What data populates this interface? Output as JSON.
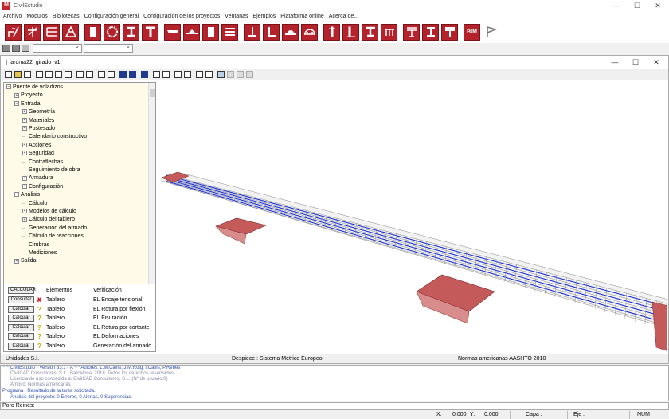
{
  "window": {
    "title": "CivilEstudio",
    "logo_text": "M",
    "minimize": "—",
    "maximize": "☐",
    "close": "✕"
  },
  "menu": [
    "Archivo",
    "Módulos",
    "Bibliotecas",
    "Configuración general",
    "Configuración de los proyectos",
    "Ventanas",
    "Ejemplos",
    "Plataforma online",
    "Acerca de..."
  ],
  "toolbar_icons": [
    "steel-section-icon",
    "beam-section-icon",
    "stacked-beam-icon",
    "truss-icon",
    "box-section-icon",
    "circular-section-icon",
    "i-beam-icon",
    "t-beam-icon",
    "deck-slab-icon",
    "arch-deck-icon",
    "document-icon",
    "stack-icon",
    "column-icon",
    "pier-icon",
    "bridge-deck-icon",
    "arch-bridge-icon",
    "single-column-icon",
    "double-column-icon",
    "girder-icon",
    "frame-icon",
    "deck-girder-icon",
    "wide-flange-icon",
    "t-girder-icon",
    "bim-icon",
    "flag-icon"
  ],
  "bim_label": "BIM",
  "child": {
    "title": "aroma22_girado_v1",
    "icon": "I",
    "minimize": "—",
    "maximize": "☐",
    "close": "✕"
  },
  "tree": [
    {
      "label": "Puente de voladizos",
      "indent": 0,
      "exp": "−"
    },
    {
      "label": "Proyecto",
      "indent": 1,
      "exp": "+"
    },
    {
      "label": "Entrada",
      "indent": 1,
      "exp": "−"
    },
    {
      "label": "Geometría",
      "indent": 2,
      "exp": "+"
    },
    {
      "label": "Materiales",
      "indent": 2,
      "exp": "+"
    },
    {
      "label": "Postesado",
      "indent": 2,
      "exp": "+"
    },
    {
      "label": "Calendario constructivo",
      "indent": 2,
      "exp": ""
    },
    {
      "label": "Acciones",
      "indent": 2,
      "exp": "+"
    },
    {
      "label": "Seguridad",
      "indent": 2,
      "exp": "+"
    },
    {
      "label": "Contraflechas",
      "indent": 2,
      "exp": ""
    },
    {
      "label": "Seguimiento de obra",
      "indent": 2,
      "exp": ""
    },
    {
      "label": "Armadura",
      "indent": 2,
      "exp": "+"
    },
    {
      "label": "Configuración",
      "indent": 2,
      "exp": "+"
    },
    {
      "label": "Análisis",
      "indent": 1,
      "exp": "−"
    },
    {
      "label": "Cálculo",
      "indent": 2,
      "exp": ""
    },
    {
      "label": "Modelos de cálculo",
      "indent": 2,
      "exp": "+"
    },
    {
      "label": "Cálculo del tablero",
      "indent": 2,
      "exp": "+"
    },
    {
      "label": "Generación del armado",
      "indent": 2,
      "exp": ""
    },
    {
      "label": "Cálculo de reacciones",
      "indent": 2,
      "exp": ""
    },
    {
      "label": "Cimbras",
      "indent": 2,
      "exp": ""
    },
    {
      "label": "Mediciones",
      "indent": 2,
      "exp": ""
    },
    {
      "label": "Salida",
      "indent": 1,
      "exp": "+"
    }
  ],
  "calc_table": {
    "header_button": "CALCULAR",
    "col_elements": "Elementos",
    "col_verification": "Verificación",
    "rows": [
      {
        "button": "Consultar",
        "status": "error",
        "element": "Tablero",
        "verification": "EL Encaje tensional"
      },
      {
        "button": "Calcular",
        "status": "pending",
        "element": "Tablero",
        "verification": "EL Rotura por flexión"
      },
      {
        "button": "Calcular",
        "status": "pending",
        "element": "Tablero",
        "verification": "EL Fisuración"
      },
      {
        "button": "Calcular",
        "status": "pending",
        "element": "Tablero",
        "verification": "EL Rotura por cortante"
      },
      {
        "button": "Calcular",
        "status": "pending",
        "element": "Tablero",
        "verification": "EL Deformaciones"
      },
      {
        "button": "Calcular",
        "status": "pending",
        "element": "Tablero",
        "verification": "Generación del armado"
      }
    ]
  },
  "status_inner": {
    "units": "Unidades S.I.",
    "despiece": "Despiece : Sistema Métrico Europeo",
    "normas": "Normas americanas  AASHTO 2010"
  },
  "log": [
    "*** CivilEstudio - Versión 33.1 - A *** Autores: L.M.Callís, J.M.Roig, I.Callís, P.Renés",
    "CivilCAD Consultores, S.L., Barcelona, 2018. Todos los derechos reservados.",
    "Licencia de uso concedida a: CivilCAD Consultores, S.L.  (Nº de usuario:0)",
    "Ámbito: Normas americanas",
    "Programa :    Resultado de la tarea solicitada.",
    "Análisis del proyecto:           0 Errores,          0 Alertas,          0 Sugerencias."
  ],
  "command": {
    "label": "Poro Reinés:"
  },
  "bottom_status": {
    "x_label": "X:",
    "x_value": "0.000",
    "y_label": "Y:",
    "y_value": "0.000",
    "capa": "Capa :",
    "eje": "Eje :",
    "num": "NUM"
  },
  "colors": {
    "brand": "#b4232b",
    "tree_bg": "#fffbe8",
    "deck_blue": "#1a2fd6",
    "pier_red": "#c45a5a"
  }
}
